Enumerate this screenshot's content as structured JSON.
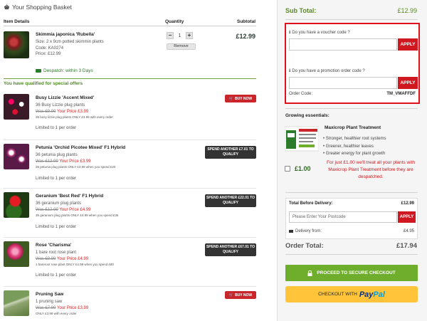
{
  "basket": {
    "title": "Your Shopping Basket",
    "headers": {
      "item": "Item Details",
      "quantity": "Quantity",
      "subtotal": "Subtotal"
    },
    "item": {
      "name": "Skimmia japonica 'Rubella'",
      "size": "Size: 2 x 9cm potted skimmin plants",
      "code": "Code: KA0274",
      "price": "Price: £12.99",
      "qty": "1",
      "remove_label": "Remove",
      "subtotal": "£12.99",
      "despatch": "Despatch: within 3 Days"
    },
    "offers_heading": "You have qualified for special offers",
    "offers": [
      {
        "name": "Busy Lizzie 'Accent Mixed'",
        "qty": "36 Busy Lizzie plug plants",
        "was": "Was £9.99",
        "your_price": "Your Price £3.99",
        "note": "36 busy lizzie plug plants ONLY £3.99 with every order",
        "limited": "Limited to 1 per order",
        "action": "BUY NOW",
        "action_type": "buy"
      },
      {
        "name": "Petunia 'Orchid Picotee Mixed' F1 Hybrid",
        "qty": "36 petunia plug plants",
        "was": "Was £12.99",
        "your_price": "Your Price £3.99",
        "note": "36 petunia plug plants ONLY £3.99 when you spend £20",
        "limited": "Limited to 1 per order",
        "action": "SPEND ANOTHER £7.01 TO QUALIFY",
        "action_type": "spend"
      },
      {
        "name": "Geranium 'Best Red' F1 Hybrid",
        "qty": "36 geranium plug plants",
        "was": "Was £12.99",
        "your_price": "Your Price £4.99",
        "note": "36 geranium plug plants ONLY £4.99 when you spend £35",
        "limited": "Limited to 1 per order",
        "action": "SPEND ANOTHER £22.01 TO QUALIFY",
        "action_type": "spend"
      },
      {
        "name": "Rose 'Charisma'",
        "qty": "1 bare root rose plant",
        "was": "Was £9.99",
        "your_price": "Your Price £4.99",
        "note": "1 bareroot rose plant ONLY £4.99 when you spend £80",
        "limited": "Limited to 1 per order",
        "action": "SPEND ANOTHER £67.01 TO QUALIFY",
        "action_type": "spend"
      },
      {
        "name": "Pruning Saw",
        "qty": "1 pruning saw",
        "was": "Was £7.99",
        "your_price": "Your Price £3.99",
        "note": "ONLY £3.99 with every order",
        "limited": "",
        "action": "BUY NOW",
        "action_type": "buy"
      }
    ]
  },
  "summary": {
    "subtotal_label": "Sub Total:",
    "subtotal": "£12.99",
    "voucher_label": "Do you have a voucher code ?",
    "promo_label": "Do you have a promotion order code ?",
    "apply": "APPLY",
    "order_code_label": "Order Code:",
    "order_code": "TM_VMAFFDF",
    "growing_title": "Growing essentials:",
    "growing_name": "Maxicrop Plant Treatment",
    "growing_bullets": [
      "Stronger, healthier root systems",
      "Greener, healthier leaves",
      "Greater energy for plant growth"
    ],
    "growing_price": "£1.00",
    "growing_promo": "For just £1.00 we'll treat all your plants with Maxicrop Plant Treatment before they are despatched.",
    "total_before_label": "Total Before Delivery:",
    "total_before": "£12.99",
    "postcode_placeholder": "Please Enter Your Postcode",
    "delivery_label": "Delivery from:",
    "delivery": "£4.95",
    "order_total_label": "Order Total:",
    "order_total": "£17.94",
    "checkout_label": "PROCEED TO SECURE CHECKOUT",
    "paypal_prefix": "CHECKOUT WITH",
    "paypal_a": "Pay",
    "paypal_b": "Pal"
  },
  "colors": {
    "green": "#6fae2c",
    "red": "#d01820",
    "dark": "#333333",
    "paypal": "#ffc439"
  }
}
